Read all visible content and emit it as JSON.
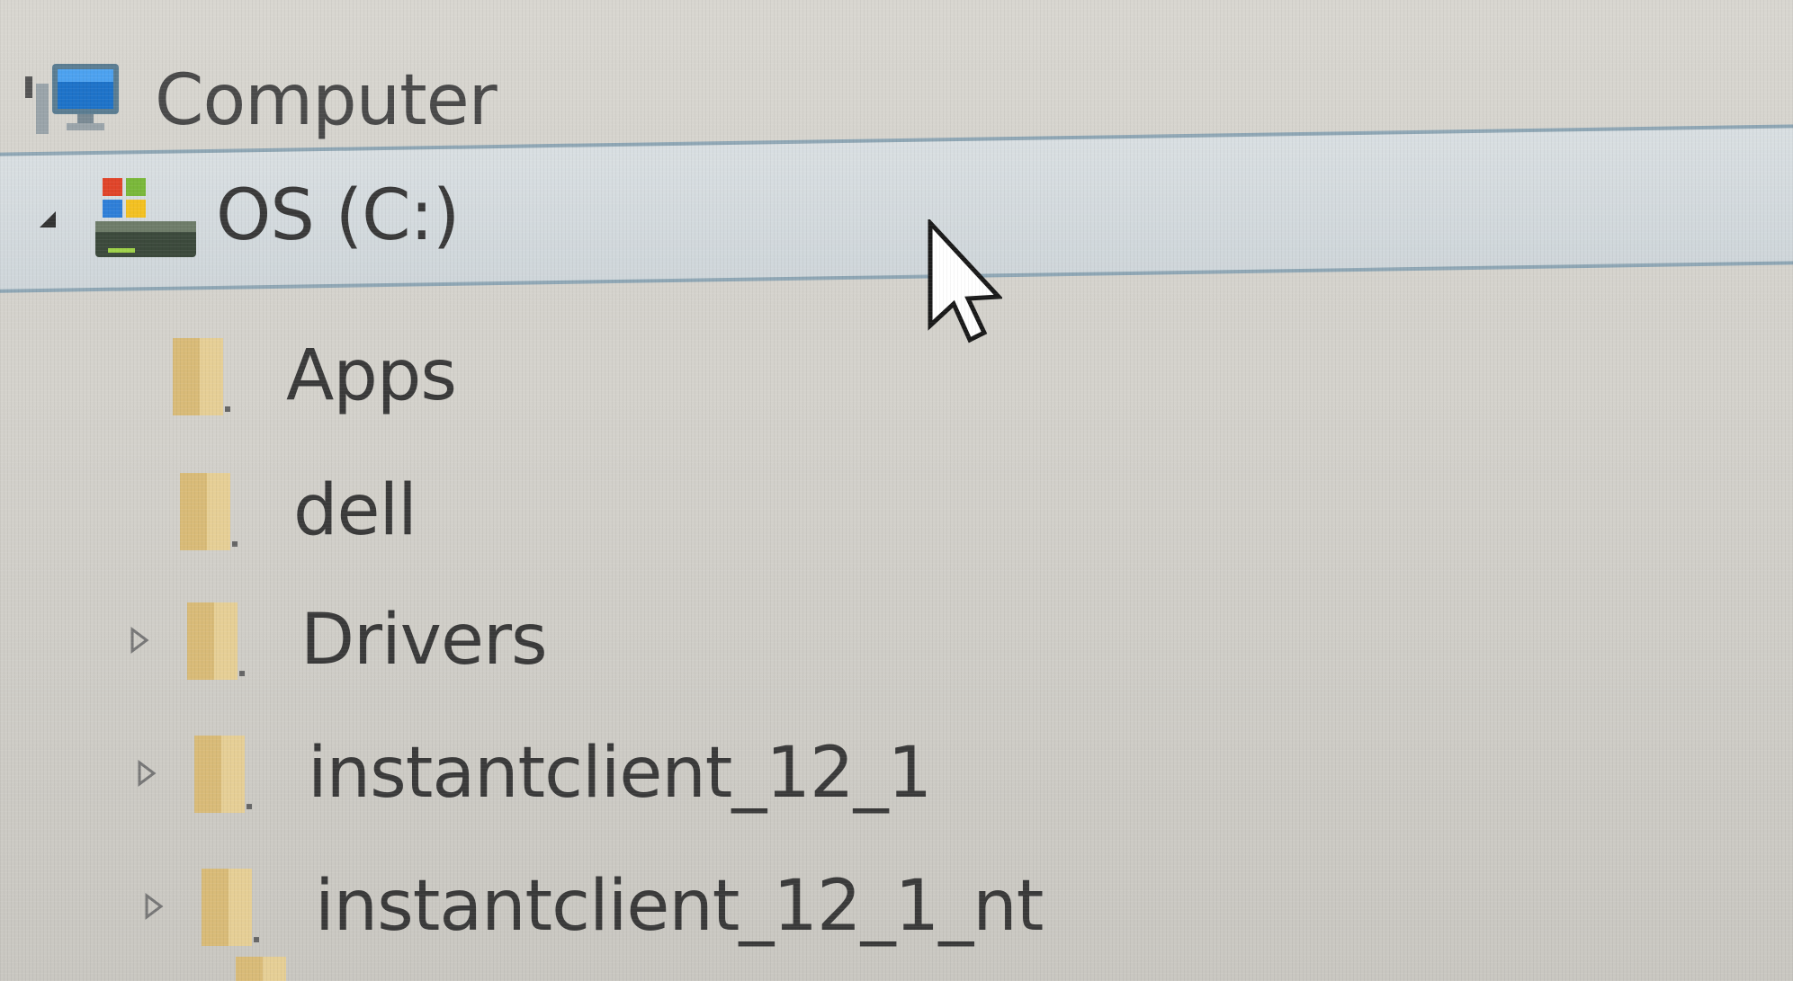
{
  "tree": {
    "root": {
      "label": "Computer",
      "icon": "computer-icon"
    },
    "drive": {
      "label": "OS (C:)",
      "icon": "windows-drive-icon",
      "expanded": true,
      "selected": true
    },
    "folders": [
      {
        "label": "Apps",
        "icon": "folder-icon",
        "has_children": false
      },
      {
        "label": "dell",
        "icon": "folder-icon",
        "has_children": false
      },
      {
        "label": "Drivers",
        "icon": "folder-icon",
        "has_children": true
      },
      {
        "label": "instantclient_12_1",
        "icon": "folder-icon",
        "has_children": true
      },
      {
        "label": "instantclient_12_1_nt",
        "icon": "folder-icon",
        "has_children": true
      }
    ]
  },
  "colors": {
    "background": "#d3d1cb",
    "selection_fill": "#d3d9dc",
    "selection_border": "#8fa7b5",
    "text": "#3a3a3a",
    "folder": "#e2c987"
  },
  "cursor": {
    "icon": "mouse-pointer-icon"
  }
}
